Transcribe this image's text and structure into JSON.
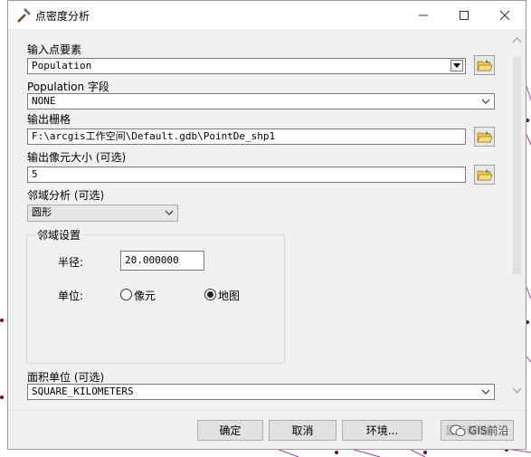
{
  "window": {
    "title": "点密度分析"
  },
  "input_points": {
    "label": "输入点要素",
    "value": "Population"
  },
  "population_field": {
    "label": "Population 字段",
    "value": "NONE"
  },
  "output_raster": {
    "label": "输出栅格",
    "value": "F:\\arcgis工作空间\\Default.gdb\\PointDe_shp1"
  },
  "cell_size": {
    "label": "输出像元大小 (可选)",
    "value": "5"
  },
  "neighborhood": {
    "label": "邻域分析 (可选)",
    "value": "圆形"
  },
  "neighborhood_settings": {
    "title": "邻域设置",
    "radius_label": "半径:",
    "radius_value": "20.000000",
    "units_label": "单位:",
    "unit_cell": "像元",
    "unit_map": "地图",
    "selected_unit": "地图"
  },
  "area_units": {
    "label": "面积单位 (可选)",
    "value": "SQUARE_KILOMETERS"
  },
  "buttons": {
    "ok": "确定",
    "cancel": "取消",
    "env": "环境...",
    "help_partial": "显示帮助"
  },
  "watermark": "GIS前沿",
  "icons": [
    "hammer-icon",
    "minimize-icon",
    "maximize-icon",
    "close-icon",
    "folder-open-icon",
    "chevron-down-icon"
  ]
}
